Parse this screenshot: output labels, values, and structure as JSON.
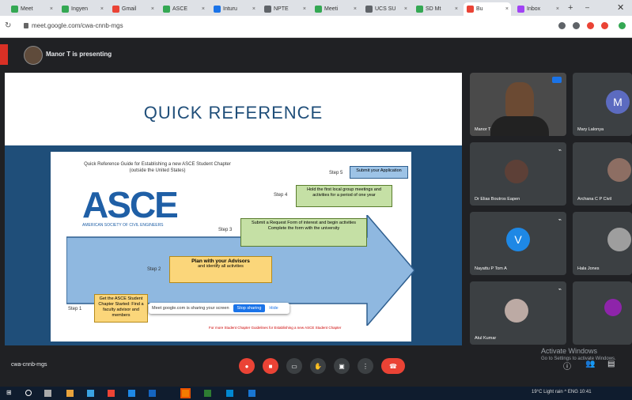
{
  "browser": {
    "tabs": [
      {
        "label": "Meet",
        "color": "#34a853"
      },
      {
        "label": "Ingyen",
        "color": "#34a853"
      },
      {
        "label": "Gmail",
        "color": "#ea4335"
      },
      {
        "label": "ASCE",
        "color": "#34a853"
      },
      {
        "label": "Inturu",
        "color": "#1a73e8"
      },
      {
        "label": "NPTE",
        "color": "#5f6368"
      },
      {
        "label": "Meeti",
        "color": "#34a853"
      },
      {
        "label": "UCS SU",
        "color": "#5f6368"
      },
      {
        "label": "SD Mt",
        "color": "#34a853"
      },
      {
        "label": "Bu",
        "color": "#ea4335",
        "active": true
      },
      {
        "label": "Inbox",
        "color": "#a142f4"
      }
    ],
    "url": "meet.google.com/cwa-cnnb-mgs"
  },
  "meet": {
    "presenter_label": "Manor T is presenting",
    "meeting_code": "cwa-cnnb-mgs",
    "activate_windows": [
      "Activate Windows",
      "Go to Settings to activate Windows."
    ]
  },
  "slide": {
    "title": "QUICK REFERENCE",
    "guide_title": "Quick Reference Guide for Establishing a new ASCE Student Chapter (outside the United States)",
    "logo_text": "ASCE",
    "logo_sub": "AMERICAN SOCIETY OF CIVIL ENGINEERS",
    "steps": [
      {
        "label": "Step 1",
        "text": "Get the ASCE Student Chapter Started: Find a faculty advisor and members"
      },
      {
        "label": "Step 2",
        "text": "Plan with your Advisors",
        "sub": "and identify all activities"
      },
      {
        "label": "Step 3",
        "text": "Submit a Request Form of interest and begin activities",
        "sub": "Complete the form with the university"
      },
      {
        "label": "Step 4",
        "text": "Hold the first local group meetings and activities for a period of one year"
      },
      {
        "label": "Step 5",
        "text": "Submit your Application"
      }
    ],
    "footnote": "For more Student Chapter Guidelines for Establishing a new ASCE Student Chapter",
    "share_popup": {
      "text": "Meet google.com is sharing your screen",
      "stop": "Stop sharing",
      "hide": "Hide"
    }
  },
  "participants": [
    {
      "name": "Manor T",
      "color": "#6b4a33"
    },
    {
      "name": "Mary Lalonya",
      "initial": "M",
      "color": "#5c6bc0"
    },
    {
      "name": "Dr Elias Boutros Eapen",
      "color": "#5d4037"
    },
    {
      "name": "Archana C P Civil",
      "color": "#8d6e63"
    },
    {
      "name": "Nayattu P Tom A",
      "initial": "V",
      "color": "#1e88e5"
    },
    {
      "name": "Hala Jones",
      "color": "#9e9e9e"
    },
    {
      "name": "Atul Kumar",
      "color": "#bcaaa4"
    },
    {
      "name": "",
      "color": "#8e24aa"
    }
  ],
  "controls": [
    {
      "name": "mic-off",
      "color": "#ea4335"
    },
    {
      "name": "camera-off",
      "color": "#ea4335"
    },
    {
      "name": "captions",
      "color": "#3c4043"
    },
    {
      "name": "raise-hand",
      "color": "#3c4043"
    },
    {
      "name": "present",
      "color": "#3c4043"
    },
    {
      "name": "more",
      "color": "#3c4043"
    },
    {
      "name": "leave-call",
      "color": "#ea4335"
    }
  ],
  "taskbar": {
    "tray_text": "19°C  Light rain  ^  ENG  10:41"
  }
}
